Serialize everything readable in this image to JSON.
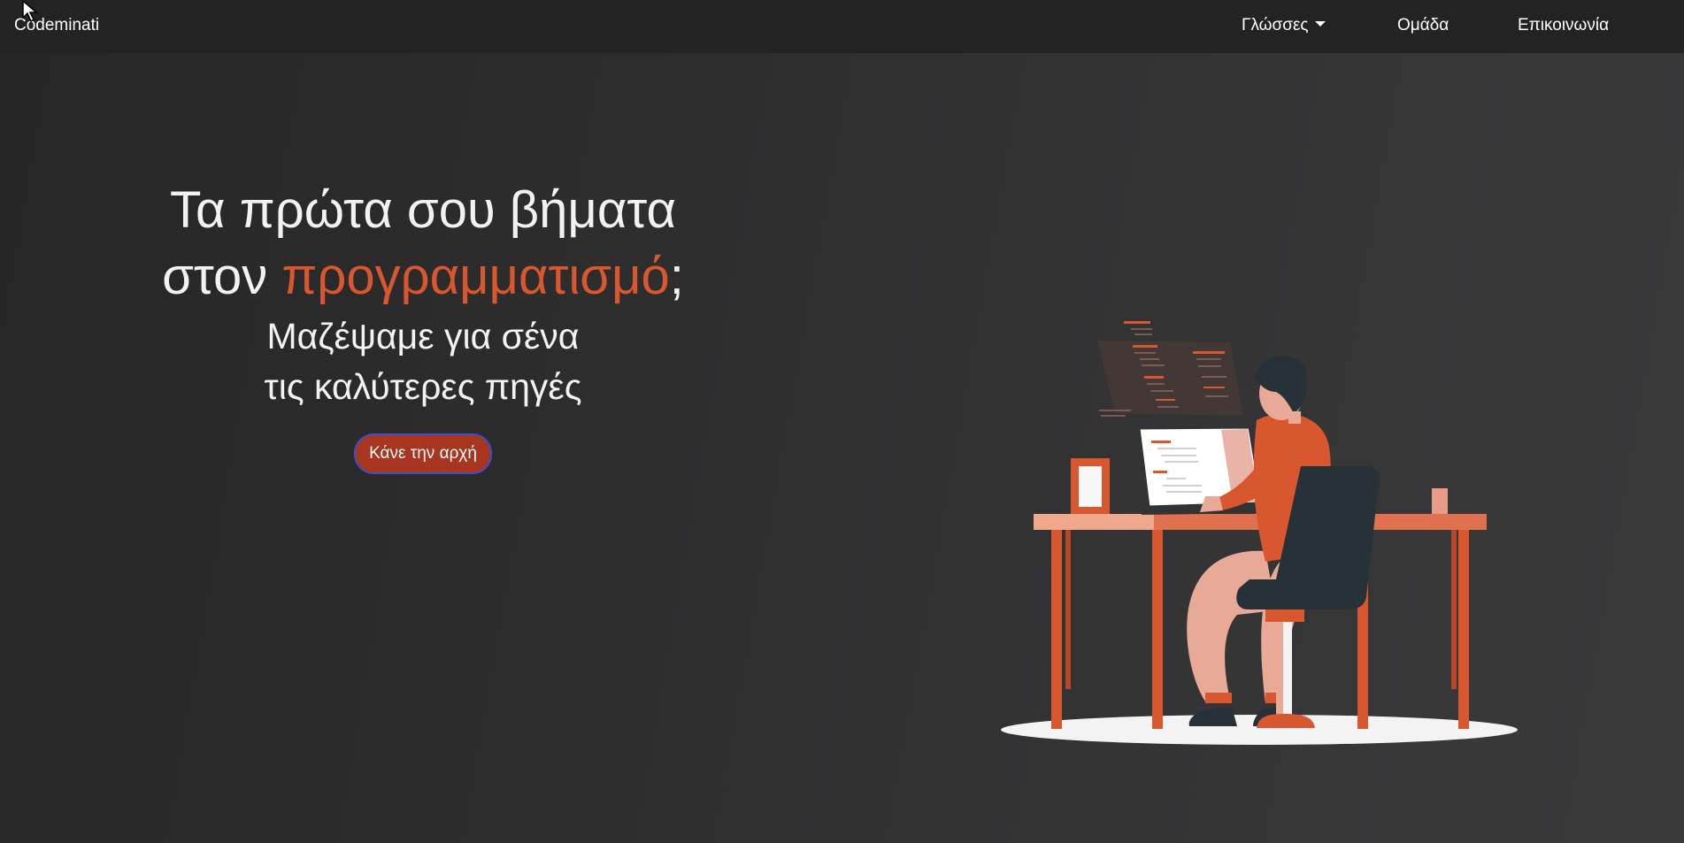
{
  "navbar": {
    "brand": "Codeminati",
    "items": [
      {
        "label": "Γλώσσες",
        "has_dropdown": true
      },
      {
        "label": "Ομάδα"
      },
      {
        "label": "Επικοινωνία"
      }
    ]
  },
  "hero": {
    "title_line1": "Τα πρώτα σου βήματα",
    "title_line2_prefix": "στον ",
    "title_line2_highlight": "προγραμματισμό",
    "title_line2_suffix": ";",
    "subtitle_line1": "Μαζέψαμε για σένα",
    "subtitle_line2": "τις καλύτερες πηγές",
    "cta_label": "Κάνε την αρχή"
  },
  "illustration": {
    "icon": "developer-at-desk-illustration"
  },
  "colors": {
    "accent": "#d9572f",
    "button_bg": "#a8351f",
    "button_border": "#3a4fc9",
    "navbar_bg": "#232323"
  }
}
